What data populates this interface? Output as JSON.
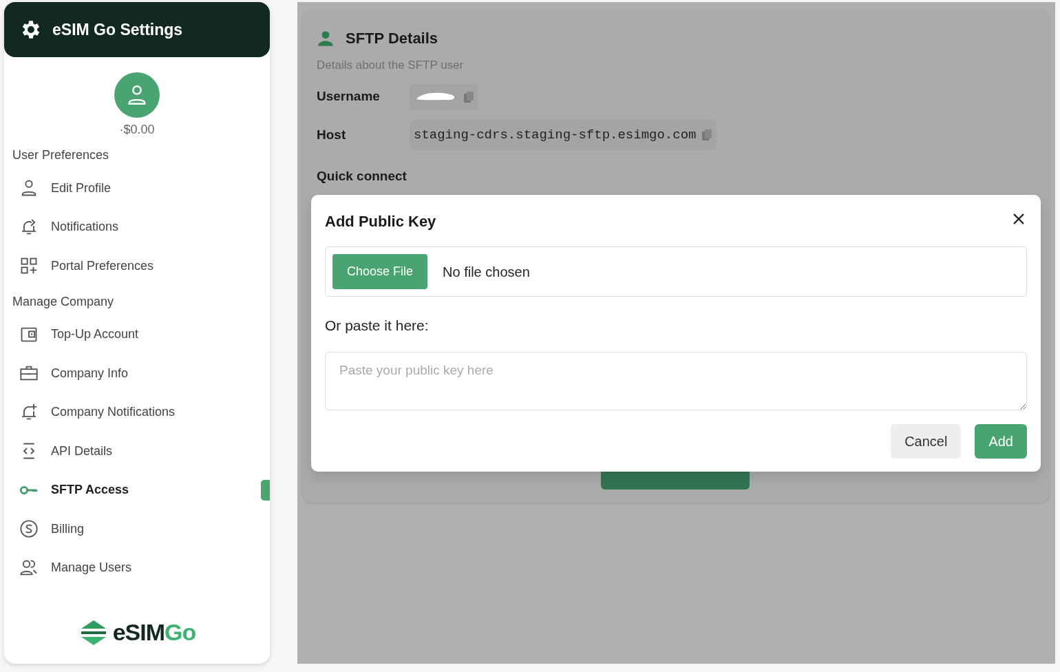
{
  "sidebar": {
    "title": "eSIM Go Settings",
    "balance": "·$0.00",
    "sections": [
      {
        "heading": "User Preferences",
        "items": [
          {
            "label": "Edit Profile",
            "selected": false
          },
          {
            "label": "Notifications",
            "selected": false
          },
          {
            "label": "Portal Preferences",
            "selected": false
          }
        ]
      },
      {
        "heading": "Manage Company",
        "items": [
          {
            "label": "Top-Up Account",
            "selected": false
          },
          {
            "label": "Company Info",
            "selected": false
          },
          {
            "label": "Company Notifications",
            "selected": false
          },
          {
            "label": "API Details",
            "selected": false
          },
          {
            "label": "SFTP Access",
            "selected": true
          },
          {
            "label": "Billing",
            "selected": false
          },
          {
            "label": "Manage Users",
            "selected": false
          }
        ]
      }
    ],
    "logo": {
      "text_dark": "eSIM",
      "text_green": "Go"
    }
  },
  "details": {
    "title": "SFTP Details",
    "subtitle": "Details about the SFTP user",
    "fields": [
      {
        "label": "Username"
      },
      {
        "label": "Host",
        "value": "staging-cdrs.staging-sftp.esimgo.com"
      }
    ],
    "quick_connect": "Quick connect"
  },
  "modal": {
    "title": "Add Public Key",
    "file_button": "Choose File",
    "file_status": "No file chosen",
    "paste_label": "Or paste it here:",
    "placeholder": "Paste your public key here",
    "buttons": [
      {
        "label": "Cancel",
        "kind": "secondary"
      },
      {
        "label": "Add",
        "kind": "primary"
      }
    ]
  }
}
